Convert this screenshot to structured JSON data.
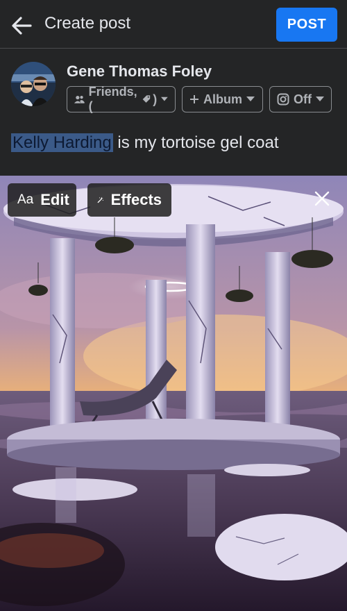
{
  "header": {
    "title": "Create post",
    "post_label": "POST"
  },
  "user": {
    "name": "Gene Thomas Foley"
  },
  "chips": {
    "audience": "Friends, (",
    "album": "Album",
    "instagram": "Off"
  },
  "post": {
    "mention": "Kelly Harding",
    "text": " is my tortoise gel coat"
  },
  "photo_tools": {
    "edit_label": "Edit",
    "effects_label": "Effects",
    "text_icon_label": "Aa"
  },
  "colors": {
    "accent": "#1877f2",
    "background": "#242526"
  }
}
